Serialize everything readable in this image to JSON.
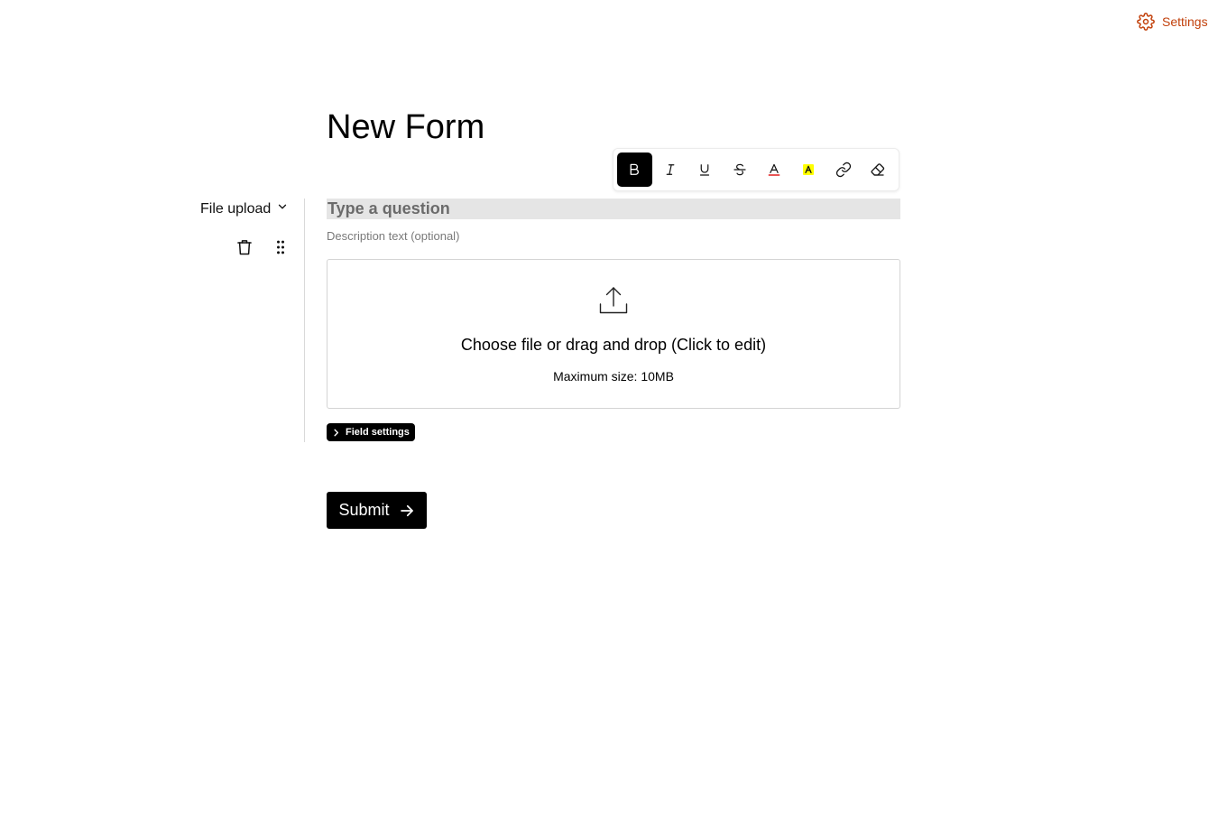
{
  "header": {
    "settings_label": "Settings",
    "settings_icon": "gear-icon",
    "accent_color": "#c2410c"
  },
  "form": {
    "title": "New Form"
  },
  "toolbar": {
    "buttons": [
      {
        "name": "bold",
        "icon": "bold-icon",
        "active": true
      },
      {
        "name": "italic",
        "icon": "italic-icon",
        "active": false
      },
      {
        "name": "underline",
        "icon": "underline-icon",
        "active": false
      },
      {
        "name": "strikethrough",
        "icon": "strikethrough-icon",
        "active": false
      },
      {
        "name": "text-color",
        "icon": "text-color-icon",
        "color": "#e11d1d",
        "active": false
      },
      {
        "name": "highlight",
        "icon": "highlight-icon",
        "color": "#ffff00",
        "active": false
      },
      {
        "name": "link",
        "icon": "link-icon",
        "active": false
      },
      {
        "name": "clear-format",
        "icon": "eraser-icon",
        "active": false
      }
    ]
  },
  "field": {
    "type_label": "File upload",
    "question_placeholder": "Type a question",
    "question_value": "",
    "description_placeholder": "Description text (optional)",
    "description_value": "",
    "upload_title": "Choose file or drag and drop (Click to edit)",
    "upload_subtitle": "Maximum size: 10MB",
    "settings_label": "Field settings"
  },
  "submit": {
    "label": "Submit"
  }
}
